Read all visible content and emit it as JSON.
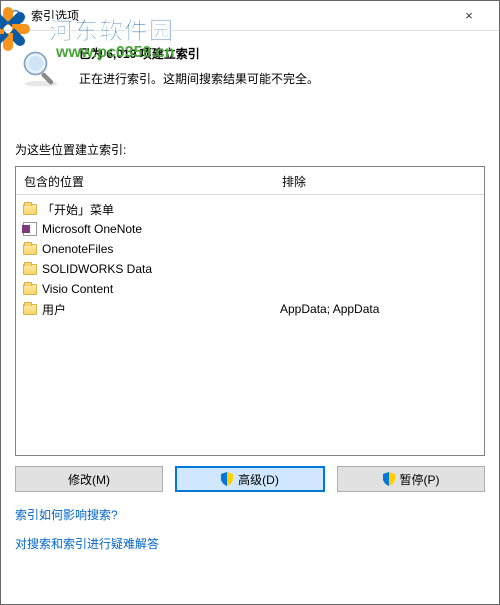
{
  "window": {
    "title": "索引选项",
    "close_label": "×"
  },
  "watermark": {
    "site_name": "河东软件园",
    "url": "www.pc0359.cn"
  },
  "status": {
    "progress_line": "已为 6,019 项建立索引",
    "message": "正在进行索引。这期间搜索结果可能不完全。"
  },
  "section_label": "为这些位置建立索引:",
  "columns": {
    "included": "包含的位置",
    "excluded": "排除"
  },
  "items": [
    {
      "label": "「开始」菜单",
      "icon": "folder",
      "exclude": ""
    },
    {
      "label": "Microsoft OneNote",
      "icon": "onenote",
      "exclude": ""
    },
    {
      "label": "OnenoteFiles",
      "icon": "folder",
      "exclude": ""
    },
    {
      "label": "SOLIDWORKS Data",
      "icon": "folder",
      "exclude": ""
    },
    {
      "label": "Visio Content",
      "icon": "folder",
      "exclude": ""
    },
    {
      "label": "用户",
      "icon": "folder",
      "exclude": "AppData; AppData"
    }
  ],
  "buttons": {
    "modify": "修改(M)",
    "advanced": "高级(D)",
    "pause": "暂停(P)"
  },
  "links": {
    "help1": "索引如何影响搜索?",
    "help2": "对搜索和索引进行疑难解答"
  }
}
